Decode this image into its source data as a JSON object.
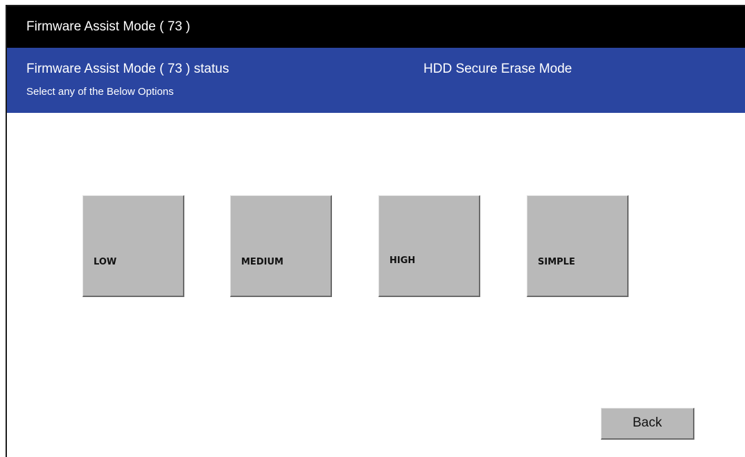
{
  "window": {
    "title": "Firmware Assist Mode ( 73 )"
  },
  "status": {
    "title": "Firmware Assist Mode ( 73 ) status",
    "mode": "HDD Secure Erase Mode",
    "subtitle": "Select any of the Below Options"
  },
  "options": [
    {
      "label": "LOW"
    },
    {
      "label": "MEDIUM"
    },
    {
      "label": "HIGH"
    },
    {
      "label": "SIMPLE"
    }
  ],
  "footer": {
    "back_label": "Back"
  },
  "colors": {
    "title_bar": "#000000",
    "status_bar": "#2a45a0",
    "button_face": "#b9b9b9"
  }
}
